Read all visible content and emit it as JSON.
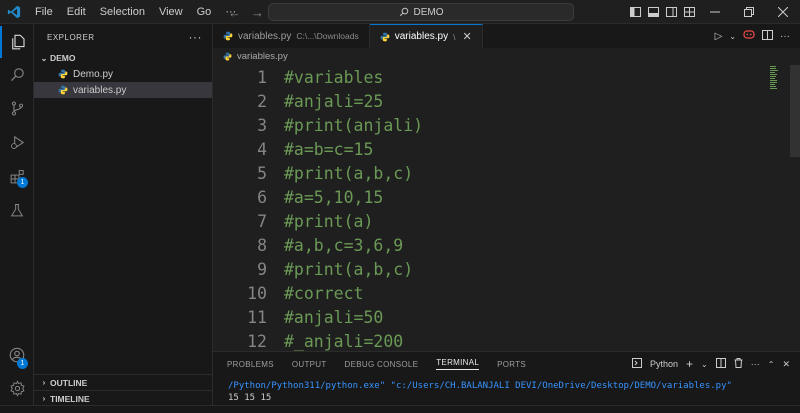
{
  "menu": [
    "File",
    "Edit",
    "Selection",
    "View",
    "Go"
  ],
  "search": {
    "label": "DEMO"
  },
  "sidebar": {
    "title": "EXPLORER",
    "folder": "DEMO",
    "files": [
      {
        "name": "Demo.py"
      },
      {
        "name": "variables.py"
      }
    ],
    "outline_label": "OUTLINE",
    "timeline_label": "TIMELINE"
  },
  "activity_badges": {
    "extensions": "1",
    "accounts": "1"
  },
  "tabs": [
    {
      "label": "variables.py",
      "description": "C:\\...\\Downloads"
    },
    {
      "label": "variables.py",
      "description": "\\"
    }
  ],
  "breadcrumb": "variables.py",
  "editor": {
    "lines": [
      {
        "num": "1",
        "text": "#variables"
      },
      {
        "num": "2",
        "text": "#anjali=25"
      },
      {
        "num": "3",
        "text": "#print(anjali)"
      },
      {
        "num": "4",
        "text": "#a=b=c=15"
      },
      {
        "num": "5",
        "text": "#print(a,b,c)"
      },
      {
        "num": "6",
        "text": "#a=5,10,15"
      },
      {
        "num": "7",
        "text": "#print(a)"
      },
      {
        "num": "8",
        "text": "#a,b,c=3,6,9"
      },
      {
        "num": "9",
        "text": "#print(a,b,c)"
      },
      {
        "num": "10",
        "text": "#correct"
      },
      {
        "num": "11",
        "text": "#anjali=50"
      },
      {
        "num": "12",
        "text": "#_anjali=200"
      }
    ]
  },
  "panel": {
    "tabs": [
      "PROBLEMS",
      "OUTPUT",
      "DEBUG CONSOLE",
      "TERMINAL",
      "PORTS"
    ],
    "active_tab": "TERMINAL",
    "terminal_name": "Python",
    "terminal_lines": [
      "/Python/Python311/python.exe\" \"c:/Users/CH.BALANJALI DEVI/OneDrive/Desktop/DEMO/variables.py\"",
      "15 15 15"
    ]
  },
  "colors": {
    "accent": "#0078d4",
    "comment": "#6a9955",
    "terminal_path": "#3794ff",
    "python_blue": "#3572a5",
    "python_yellow": "#ffd43b"
  }
}
